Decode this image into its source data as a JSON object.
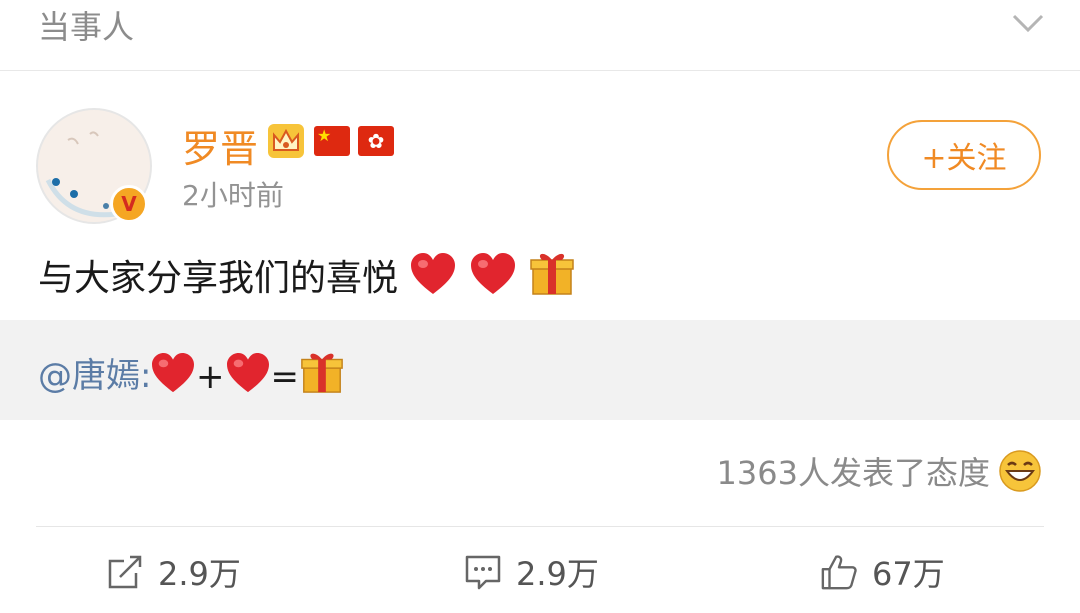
{
  "section": {
    "title": "当事人",
    "collapse_icon": "chevron-down-icon"
  },
  "post": {
    "author": {
      "name": "罗晋",
      "avatar_icon": "avatar-cartoon-baby",
      "badges": [
        "crown-icon",
        "china-flag-icon",
        "hong-kong-flag-icon"
      ],
      "verified_icon": "vip-v-badge",
      "verified_letter": "V"
    },
    "timestamp": "2小时前",
    "follow_label": "+关注",
    "text": "与大家分享我们的喜悦",
    "text_emojis": [
      "heart-emoji",
      "heart-emoji",
      "gift-emoji"
    ],
    "quote": {
      "mention": "@唐嫣",
      "colon": ":",
      "plus": "+",
      "equals": "=",
      "emojis": [
        "heart-emoji",
        "heart-emoji",
        "gift-emoji"
      ]
    },
    "reactions_text": "1363人发表了态度",
    "reactions_icon": "grin-emoji"
  },
  "actions": {
    "repost": {
      "icon": "repost-icon",
      "count": "2.9万"
    },
    "comment": {
      "icon": "comment-icon",
      "count": "2.9万"
    },
    "like": {
      "icon": "thumbs-up-icon",
      "count": "67万"
    }
  },
  "colors": {
    "accent": "#f08a24",
    "mention": "#5b7ca6",
    "muted": "#939393",
    "quote_bg": "#f2f2f2"
  }
}
